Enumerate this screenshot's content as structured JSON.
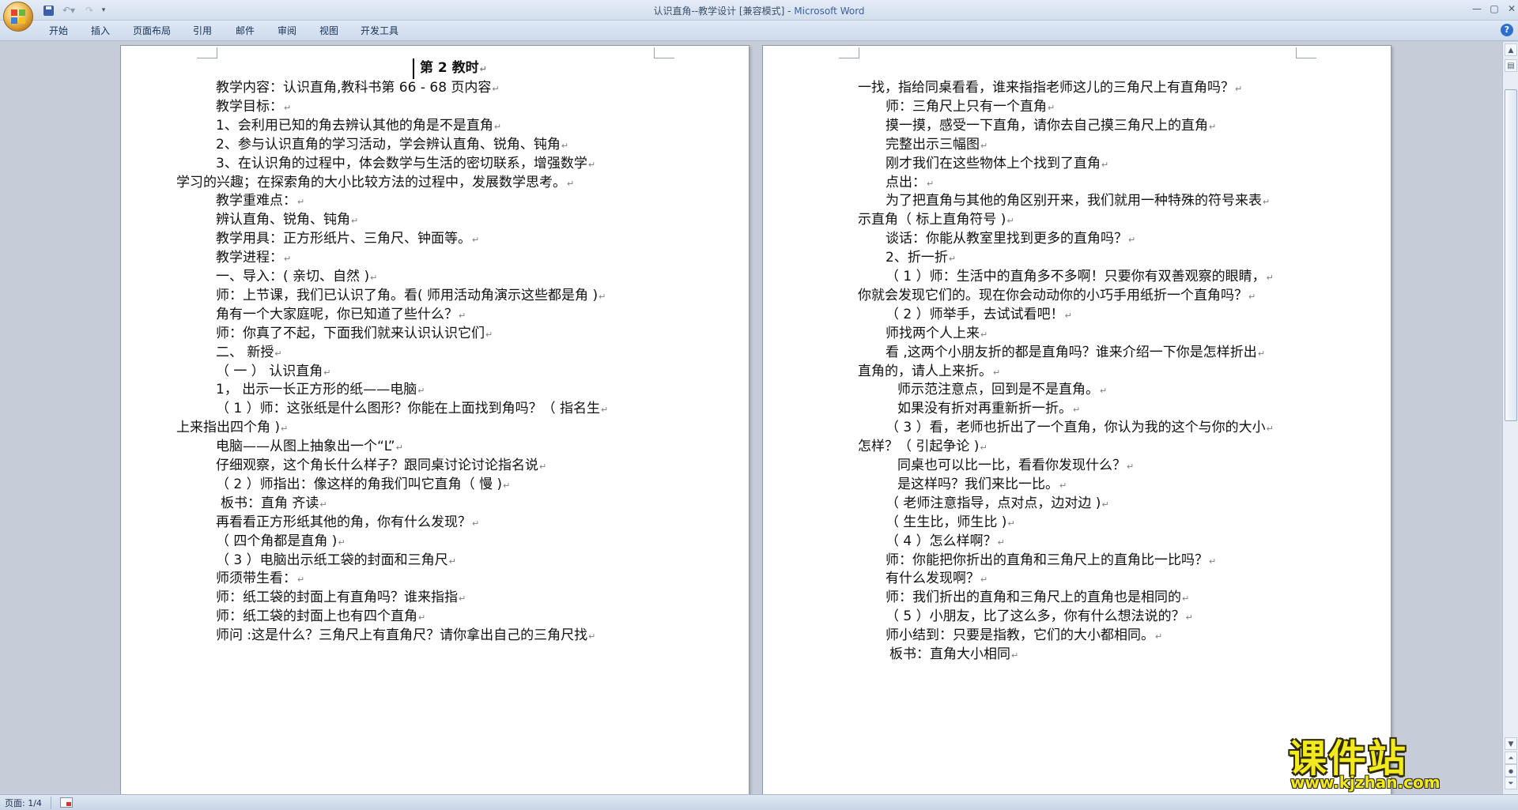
{
  "window": {
    "title_doc": "认识直角--教学设计 [兼容模式]",
    "title_sep": " - ",
    "title_app": "Microsoft Word"
  },
  "ribbon": {
    "tabs": [
      "开始",
      "插入",
      "页面布局",
      "引用",
      "邮件",
      "审阅",
      "视图",
      "开发工具"
    ]
  },
  "document": {
    "heading": "第 2 教时",
    "left_page": [
      "教学内容：认识直角,教科书第 66 - 68 页内容",
      "教学目标：",
      "1、会利用已知的角去辨认其他的角是不是直角",
      "2、参与认识直角的学习活动，学会辨认直角、锐角、钝角",
      "3、在认识角的过程中，体会数学与生活的密切联系，增强数学",
      "学习的兴趣；在探索角的大小比较方法的过程中，发展数学思考。",
      "教学重难点：",
      "辨认直角、锐角、钝角",
      "教学用具：正方形纸片、三角尺、钟面等。",
      "教学进程：",
      "一、导入：( 亲切、自然 )",
      "师：上节课，我们已认识了角。看( 师用活动角演示这些都是角 )",
      "角有一个大家庭呢，你已知道了些什么？",
      "师：你真了不起，下面我们就来认识认识它们",
      "二、  新授",
      "（ 一 ）   认识直角",
      "1，   出示一长正方形的纸——电脑",
      "（ 1 ）师：这张纸是什么图形？你能在上面找到角吗？（ 指名生",
      "上来指出四个角 )",
      "电脑——从图上抽象出一个“L”",
      "仔细观察，这个角长什么样子？跟同桌讨论讨论指名说",
      "（ 2 ）师指出：像这样的角我们叫它直角（ 慢 )",
      "板书：直角   齐读",
      "再看看正方形纸其他的角，你有什么发现？",
      "（ 四个角都是直角 )",
      "（ 3 ）电脑出示纸工袋的封面和三角尺",
      "师须带生看：",
      "师：纸工袋的封面上有直角吗？谁来指指",
      "师：纸工袋的封面上也有四个直角",
      "师问 :这是什么？三角尺上有直角尺？请你拿出自己的三角尺找"
    ],
    "right_page": [
      "一找，指给同桌看看，谁来指指老师这儿的三角尺上有直角吗？",
      "师：三角尺上只有一个直角",
      "摸一摸，感受一下直角，请你去自己摸三角尺上的直角",
      "完整出示三幅图",
      "刚才我们在这些物体上个找到了直角",
      "点出：",
      "为了把直角与其他的角区别开来，我们就用一种特殊的符号来表",
      "示直角（ 标上直角符号 )",
      "谈话：你能从教室里找到更多的直角吗？",
      "2、折一折",
      "（ 1 ）师：生活中的直角多不多啊！只要你有双善观察的眼睛，",
      "你就会发现它们的。现在你会动动你的小巧手用纸折一个直角吗？",
      "（ 2 ）师举手，去试试看吧！",
      "师找两个人上来",
      "看 ,这两个小朋友折的都是直角吗？谁来介绍一下你是怎样折出",
      "直角的，请人上来折。",
      "师示范注意点，回到是不是直角。",
      "如果没有折对再重新折一折。",
      "（ 3 ）看，老师也折出了一个直角，你认为我的这个与你的大小",
      "怎样？（ 引起争论 )",
      "同桌也可以比一比，看看你发现什么？",
      "是这样吗？我们来比一比。",
      "（ 老师注意指导，点对点，边对边 )",
      "（ 生生比，师生比 )",
      "（ 4 ）怎么样啊？",
      "师：你能把你折出的直角和三角尺上的直角比一比吗？",
      "有什么发现啊？",
      "师：我们折出的直角和三角尺上的直角也是相同的",
      "（ 5 ）小朋友，比了这么多，你有什么想法说的？",
      "师小结到：只要是指教，它们的大小都相同。",
      "板书：直角大小相同"
    ]
  },
  "statusbar": {
    "page": "页面: 1/4"
  },
  "watermark": {
    "text": "课件站",
    "url": "www.kjzhan.com"
  }
}
